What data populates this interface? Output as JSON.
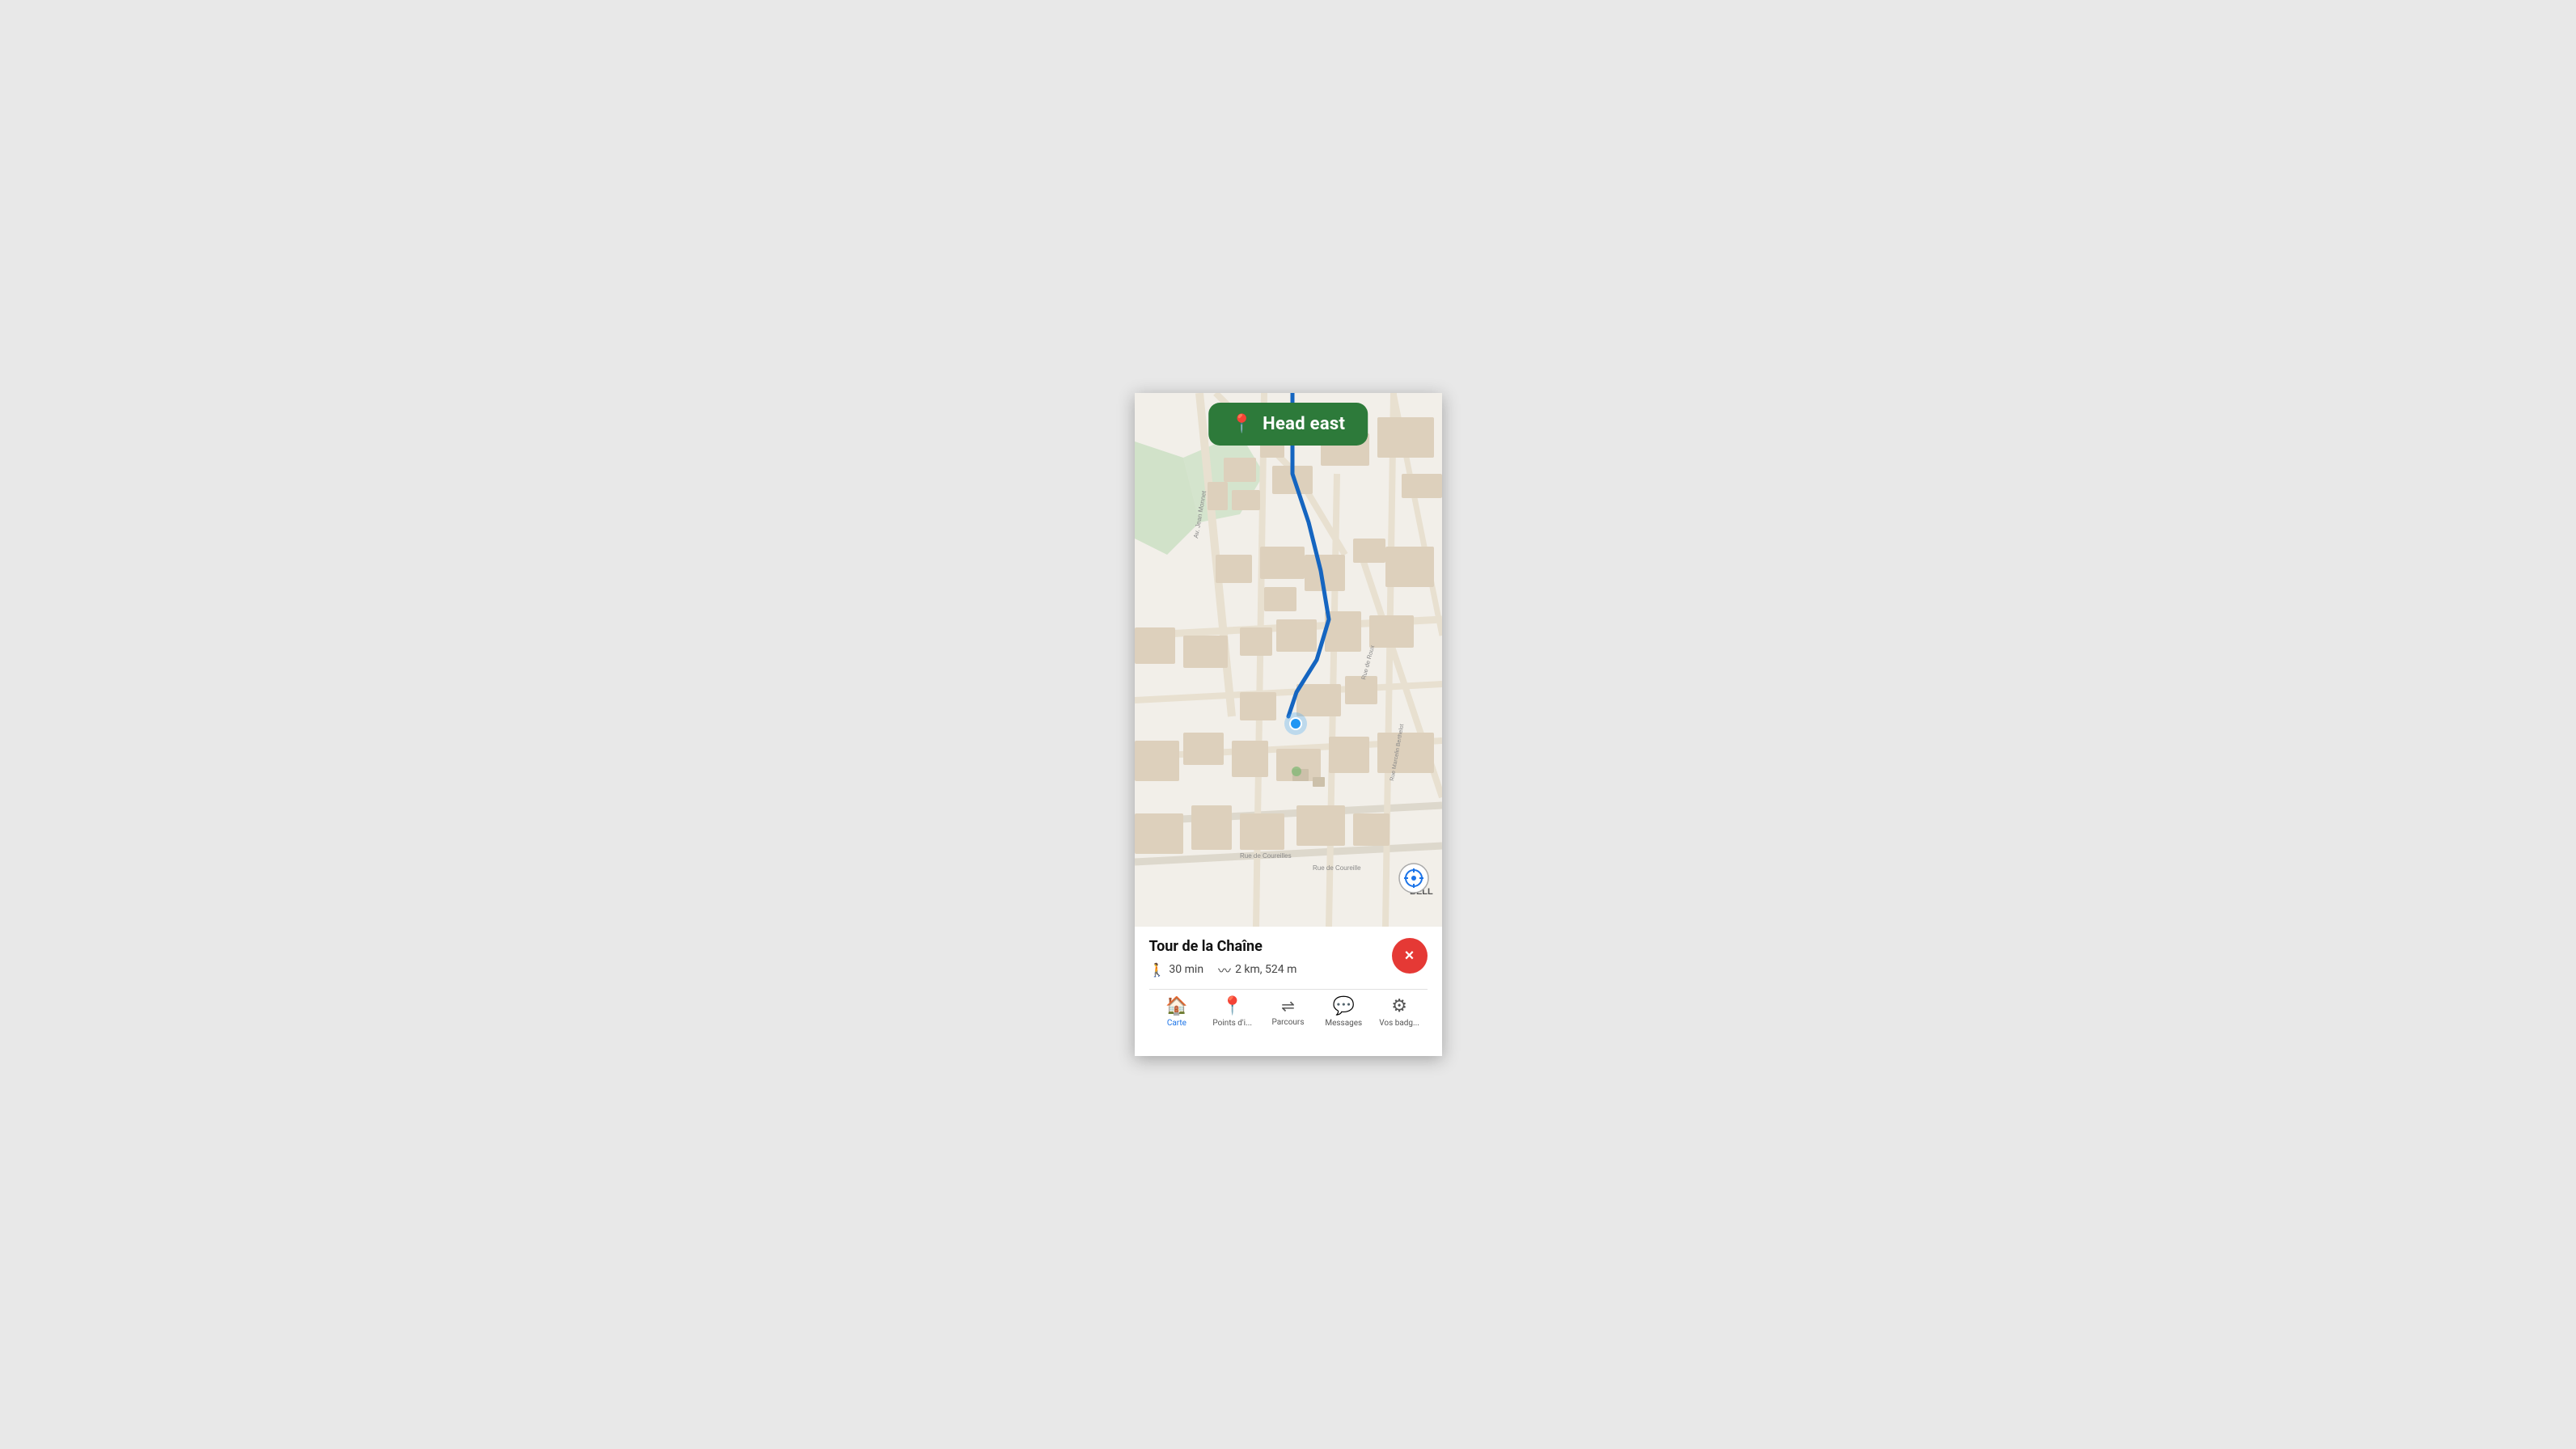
{
  "nav_banner": {
    "text": "Head east",
    "icon": "📍"
  },
  "map": {
    "route_color": "#1565C0",
    "location_color": "#2196F3"
  },
  "destination": {
    "name": "Tour de la Chaîne",
    "duration": "30 min",
    "distance": "2 km, 524 m"
  },
  "close_button": {
    "label": "×"
  },
  "bottom_nav": [
    {
      "id": "carte",
      "label": "Carte",
      "icon": "🏠",
      "active": true
    },
    {
      "id": "points",
      "label": "Points d'i...",
      "icon": "📍",
      "active": false
    },
    {
      "id": "parcours",
      "label": "Parcours",
      "icon": "〰",
      "active": false
    },
    {
      "id": "messages",
      "label": "Messages",
      "icon": "💬",
      "active": false
    },
    {
      "id": "badges",
      "label": "Vos badg...",
      "icon": "⚙",
      "active": false
    }
  ],
  "street_labels": [
    "Av. Jean Monnet",
    "Rue de Roux",
    "Rue Marcelin Berthelot",
    "Rue de Coureilles",
    "Rue de Coureille",
    "BELL"
  ]
}
